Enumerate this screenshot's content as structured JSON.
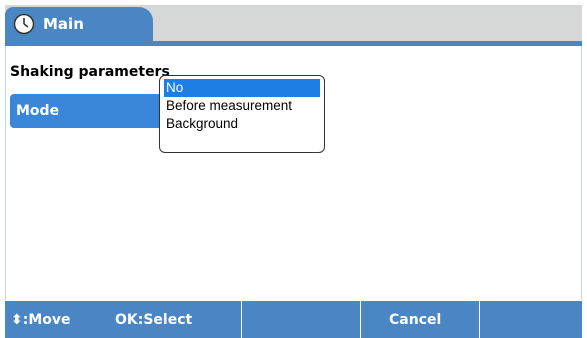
{
  "tab": {
    "label": "Main",
    "icon": "clock-icon"
  },
  "section": {
    "title": "Shaking parameters"
  },
  "mode_row": {
    "label": "Mode"
  },
  "dropdown": {
    "options": [
      "No",
      "Before measurement",
      "Background"
    ],
    "selected": "No"
  },
  "bottom_bar": {
    "move_label": ":Move",
    "ok_label": "OK:Select",
    "cancel_label": "Cancel"
  },
  "colors": {
    "accent": "#4b86c4",
    "selection": "#1d7fe6",
    "tabbar_bg": "#d6d8d8"
  }
}
